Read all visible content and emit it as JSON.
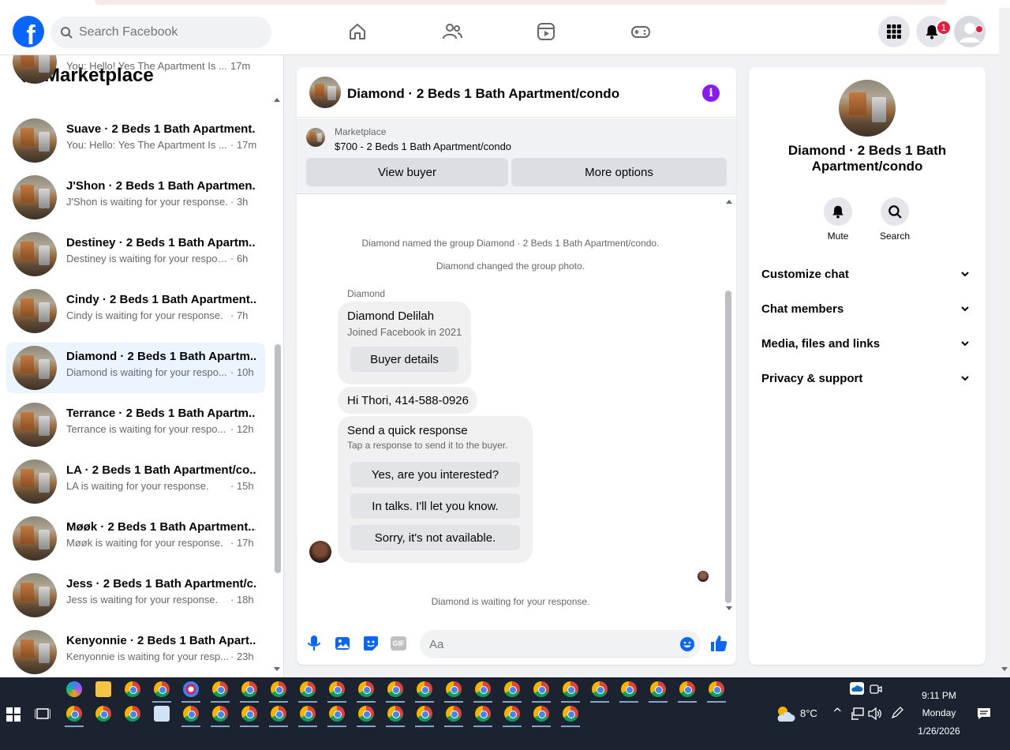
{
  "nav": {
    "logo": "f",
    "search_placeholder": "Search Facebook",
    "notification_count": "1"
  },
  "sidebar": {
    "title": "Marketplace",
    "partial_preview": "You: Hello! Yes The Apartment Is ...",
    "partial_time": "17m",
    "conversations": [
      {
        "name": "Suave · 2 Beds 1 Bath Apartment...",
        "preview": "You: Hello: Yes The Apartment Is ...",
        "time": "· 17m"
      },
      {
        "name": "J'Shon · 2 Beds 1 Bath Apartmen...",
        "preview": "J'Shon is waiting for your response.",
        "time": "· 3h"
      },
      {
        "name": "Destiney · 2 Beds 1 Bath Apartm...",
        "preview": "Destiney is waiting for your respon...",
        "time": "· 6h"
      },
      {
        "name": "Cindy · 2 Beds 1 Bath Apartment...",
        "preview": "Cindy is waiting for your response.",
        "time": "· 7h"
      },
      {
        "name": "Diamond · 2 Beds 1 Bath Apartm...",
        "preview": "Diamond is waiting for your respo...",
        "time": "· 10h"
      },
      {
        "name": "Terrance · 2 Beds 1 Bath Apartm...",
        "preview": "Terrance is waiting for your respo...",
        "time": "· 12h"
      },
      {
        "name": "LA · 2 Beds 1 Bath Apartment/co...",
        "preview": "LA is waiting for your response.",
        "time": "· 15h"
      },
      {
        "name": "Møøk · 2 Beds 1 Bath Apartment...",
        "preview": "Møøk is waiting for your response.",
        "time": "· 17h"
      },
      {
        "name": "Jess · 2 Beds 1 Bath Apartment/c...",
        "preview": "Jess is waiting for your response.",
        "time": "· 18h"
      },
      {
        "name": "Kenyonnie · 2 Beds 1 Bath Apart...",
        "preview": "Kenyonnie is waiting for your resp...",
        "time": "· 23h"
      }
    ]
  },
  "chat": {
    "title": "Diamond · 2 Beds 1 Bath Apartment/condo",
    "marketplace_label": "Marketplace",
    "listing": "$700 - 2 Beds 1 Bath Apartment/condo",
    "view_buyer": "View buyer",
    "more_options": "More options",
    "sys_1": "Diamond named the group Diamond · 2 Beds 1 Bath Apartment/condo.",
    "sys_2": "Diamond changed the group photo.",
    "sender": "Diamond",
    "buyer_name": "Diamond Delilah",
    "buyer_joined": "Joined Facebook in 2021",
    "buyer_details": "Buyer details",
    "message": "Hi Thori, 414-588-0926",
    "quick_title": "Send a quick response",
    "quick_sub": "Tap a response to send it to the buyer.",
    "quick_responses": [
      "Yes, are you interested?",
      "In talks. I'll let you know.",
      "Sorry, it's not available."
    ],
    "waiting": "Diamond is waiting for your response.",
    "input_placeholder": "Aa",
    "gif_label": "GIF"
  },
  "right_panel": {
    "title": "Diamond · 2 Beds 1 Bath Apartment/condo",
    "mute": "Mute",
    "search": "Search",
    "sections": [
      "Customize chat",
      "Chat members",
      "Media, files and links",
      "Privacy & support"
    ]
  },
  "taskbar": {
    "time": "9:11 PM",
    "day": "Monday",
    "date": "1/26/2026",
    "temperature": "8°C"
  },
  "colors": {
    "brand_blue": "#0866ff",
    "active_row": "#ebf5ff",
    "badge_red": "#e41e3f",
    "info_purple": "#8a1bf0"
  }
}
